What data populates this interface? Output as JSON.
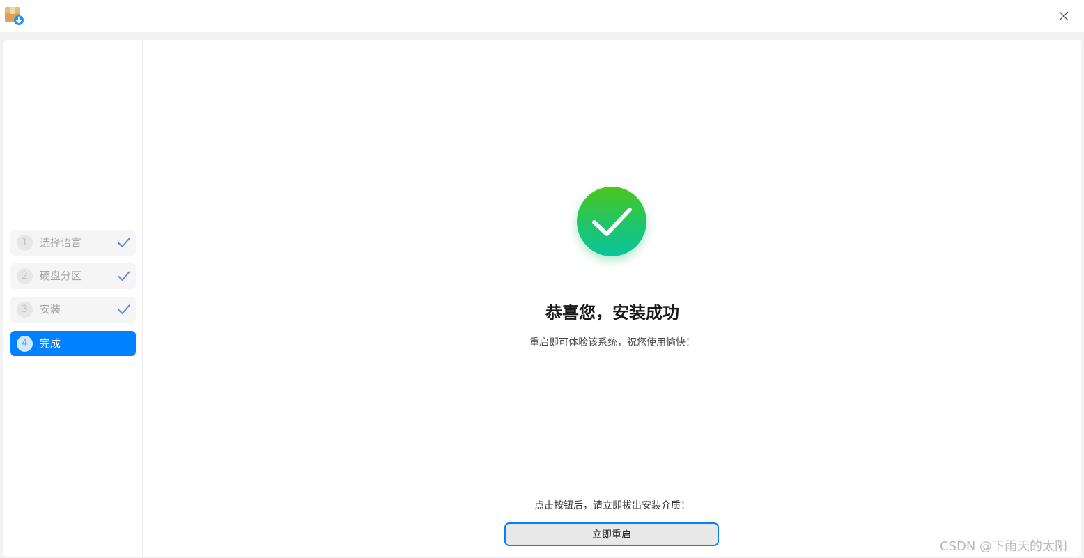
{
  "window": {
    "app_icon": "installer-package-icon",
    "close_icon": "close-icon"
  },
  "sidebar": {
    "steps": [
      {
        "number": "1",
        "label": "选择语言",
        "state": "done"
      },
      {
        "number": "2",
        "label": "硬盘分区",
        "state": "done"
      },
      {
        "number": "3",
        "label": "安装",
        "state": "done"
      },
      {
        "number": "4",
        "label": "完成",
        "state": "active"
      }
    ]
  },
  "main": {
    "status_icon": "success-check-icon",
    "title": "恭喜您，安装成功",
    "subtitle": "重启即可体验该系统，祝您使用愉快！",
    "reminder": "点击按钮后，请立即拔出安装介质！",
    "reboot_label": "立即重启"
  },
  "watermark": "CSDN @下雨天的太阳",
  "colors": {
    "accent": "#0081ff",
    "success_top": "#4cc61e",
    "success_bottom": "#0bc49d",
    "check_done": "#6f7fc9"
  }
}
